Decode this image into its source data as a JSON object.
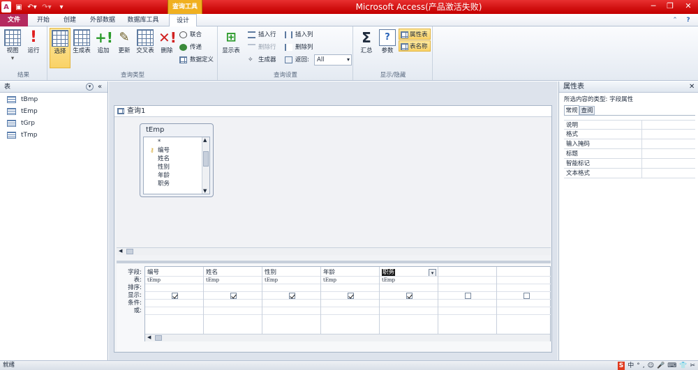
{
  "window": {
    "app_title": "Microsoft Access(产品激活失败)",
    "context_tab": "查询工具",
    "controls": {
      "minimize": "─",
      "restore": "❐",
      "close": "✕"
    }
  },
  "tabs": [
    "文件",
    "开始",
    "创建",
    "外部数据",
    "数据库工具",
    "设计"
  ],
  "ribbon": {
    "groups": {
      "results": "结果",
      "query_type": "查询类型",
      "query_setup": "查询设置",
      "show_hide": "显示/隐藏"
    },
    "buttons": {
      "view": "视图",
      "run": "运行",
      "select": "选择",
      "make_table": "生成表",
      "append": "追加",
      "update": "更新",
      "crosstab": "交叉表",
      "delete": "删除",
      "union": "联合",
      "pass_through": "传递",
      "data_definition": "数据定义",
      "show_table": "显示表",
      "insert_row": "插入行",
      "delete_row": "删除行",
      "builder": "生成器",
      "insert_col": "插入列",
      "delete_col": "删除列",
      "return_label": "返回:",
      "return_value": "All",
      "totals": "汇总",
      "parameters": "参数",
      "property_sheet": "属性表",
      "table_names": "表名称",
      "sigma": "Σ"
    }
  },
  "nav": {
    "header": "表",
    "items": [
      "tBmp",
      "tEmp",
      "tGrp",
      "tTmp"
    ]
  },
  "query": {
    "title": "查询1",
    "table_box": {
      "name": "tEmp",
      "fields": [
        "*",
        "编号",
        "姓名",
        "性别",
        "年龄",
        "职务"
      ]
    },
    "row_labels": [
      "字段:",
      "表:",
      "排序:",
      "显示:",
      "条件:",
      "或:"
    ],
    "columns": [
      {
        "field": "编号",
        "table": "tEmp",
        "show": true
      },
      {
        "field": "姓名",
        "table": "tEmp",
        "show": true
      },
      {
        "field": "性别",
        "table": "tEmp",
        "show": true
      },
      {
        "field": "年龄",
        "table": "tEmp",
        "show": true
      },
      {
        "field": "职务",
        "table": "tEmp",
        "show": true
      },
      {
        "field": "",
        "table": "",
        "show": false
      },
      {
        "field": "",
        "table": "",
        "show": false
      }
    ]
  },
  "property_sheet": {
    "title": "属性表",
    "selection_type": "所选内容的类型: 字段属性",
    "tabs": [
      "常规",
      "查阅"
    ],
    "properties": [
      "说明",
      "格式",
      "输入掩码",
      "标题",
      "智能标记",
      "文本格式"
    ]
  },
  "status": {
    "text": "就绪",
    "tray": [
      "S",
      "中",
      "°",
      ",",
      "☺",
      "🎤",
      "⌨",
      "👕",
      "✂"
    ]
  },
  "colors": {
    "title_red": "#d00f0f",
    "file_tab": "#b52a5f",
    "context_tab": "#f0b020"
  }
}
